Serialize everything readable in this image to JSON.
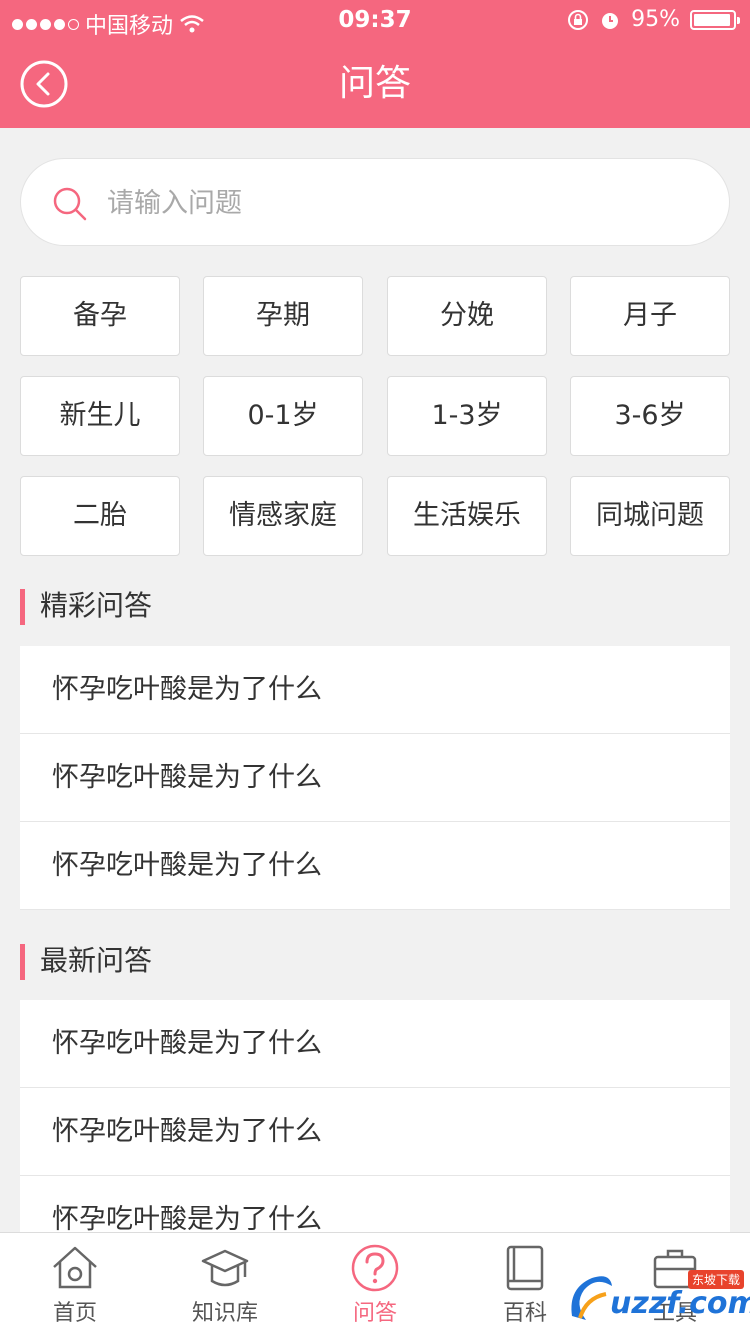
{
  "status_bar": {
    "carrier": "中国移动",
    "time": "09:37",
    "battery": "95%"
  },
  "header": {
    "title": "问答"
  },
  "search": {
    "placeholder": "请输入问题"
  },
  "categories": [
    "备孕",
    "孕期",
    "分娩",
    "月子",
    "新生儿",
    "0-1岁",
    "1-3岁",
    "3-6岁",
    "二胎",
    "情感家庭",
    "生活娱乐",
    "同城问题"
  ],
  "featured": {
    "title": "精彩问答",
    "items": [
      "怀孕吃叶酸是为了什么",
      "怀孕吃叶酸是为了什么",
      "怀孕吃叶酸是为了什么"
    ]
  },
  "latest": {
    "title": "最新问答",
    "items": [
      "怀孕吃叶酸是为了什么",
      "怀孕吃叶酸是为了什么",
      "怀孕吃叶酸是为了什么"
    ]
  },
  "tabbar": {
    "items": [
      {
        "label": "首页",
        "icon": "home-icon"
      },
      {
        "label": "知识库",
        "icon": "graduation-cap-icon"
      },
      {
        "label": "问答",
        "icon": "question-icon"
      },
      {
        "label": "百科",
        "icon": "book-icon"
      },
      {
        "label": "工具",
        "icon": "toolbox-icon"
      }
    ],
    "active": "问答"
  },
  "watermark": {
    "text": "uzzf.com",
    "badge": "东坡下载"
  },
  "colors": {
    "accent": "#f5677f",
    "background": "#f1f1f1"
  }
}
